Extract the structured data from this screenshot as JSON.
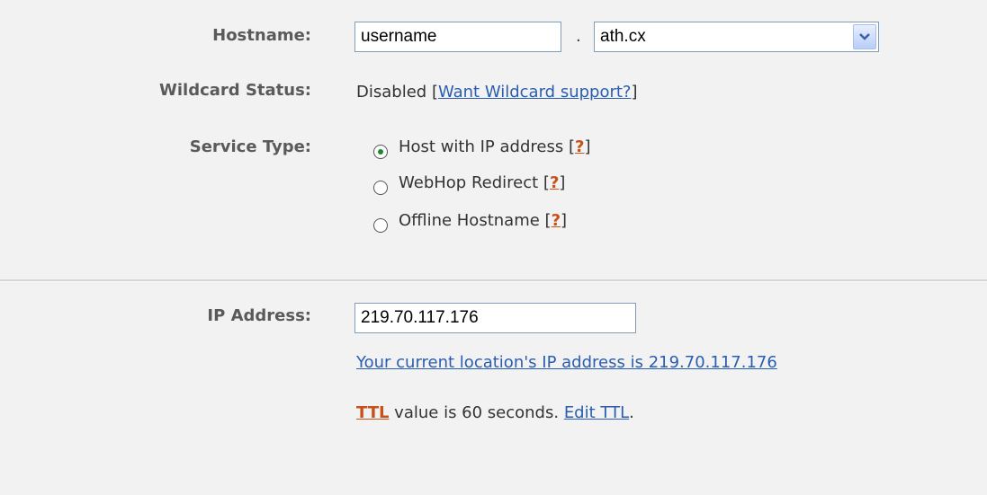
{
  "hostname": {
    "label": "Hostname:",
    "value": "username",
    "separator": ".",
    "domain": "ath.cx"
  },
  "wildcard": {
    "label": "Wildcard Status:",
    "status": "Disabled",
    "open_bracket": "[",
    "link": "Want Wildcard support?",
    "close_bracket": "]"
  },
  "service_type": {
    "label": "Service Type:",
    "options": [
      {
        "label": "Host with IP address",
        "checked": true
      },
      {
        "label": "WebHop Redirect",
        "checked": false
      },
      {
        "label": "Offline Hostname",
        "checked": false
      }
    ],
    "help_open": "[",
    "help": "?",
    "help_close": "]"
  },
  "ip": {
    "label": "IP Address:",
    "value": "219.70.117.176",
    "current_link": "Your current location's IP address is 219.70.117.176"
  },
  "ttl": {
    "link": "TTL",
    "text": " value is 60 seconds. ",
    "edit_link": "Edit TTL",
    "end": "."
  },
  "colors": {
    "link": "#2a5db0",
    "help": "#c8511a",
    "radio_checked": "#1b8a2e",
    "background": "#f2f2f2"
  }
}
